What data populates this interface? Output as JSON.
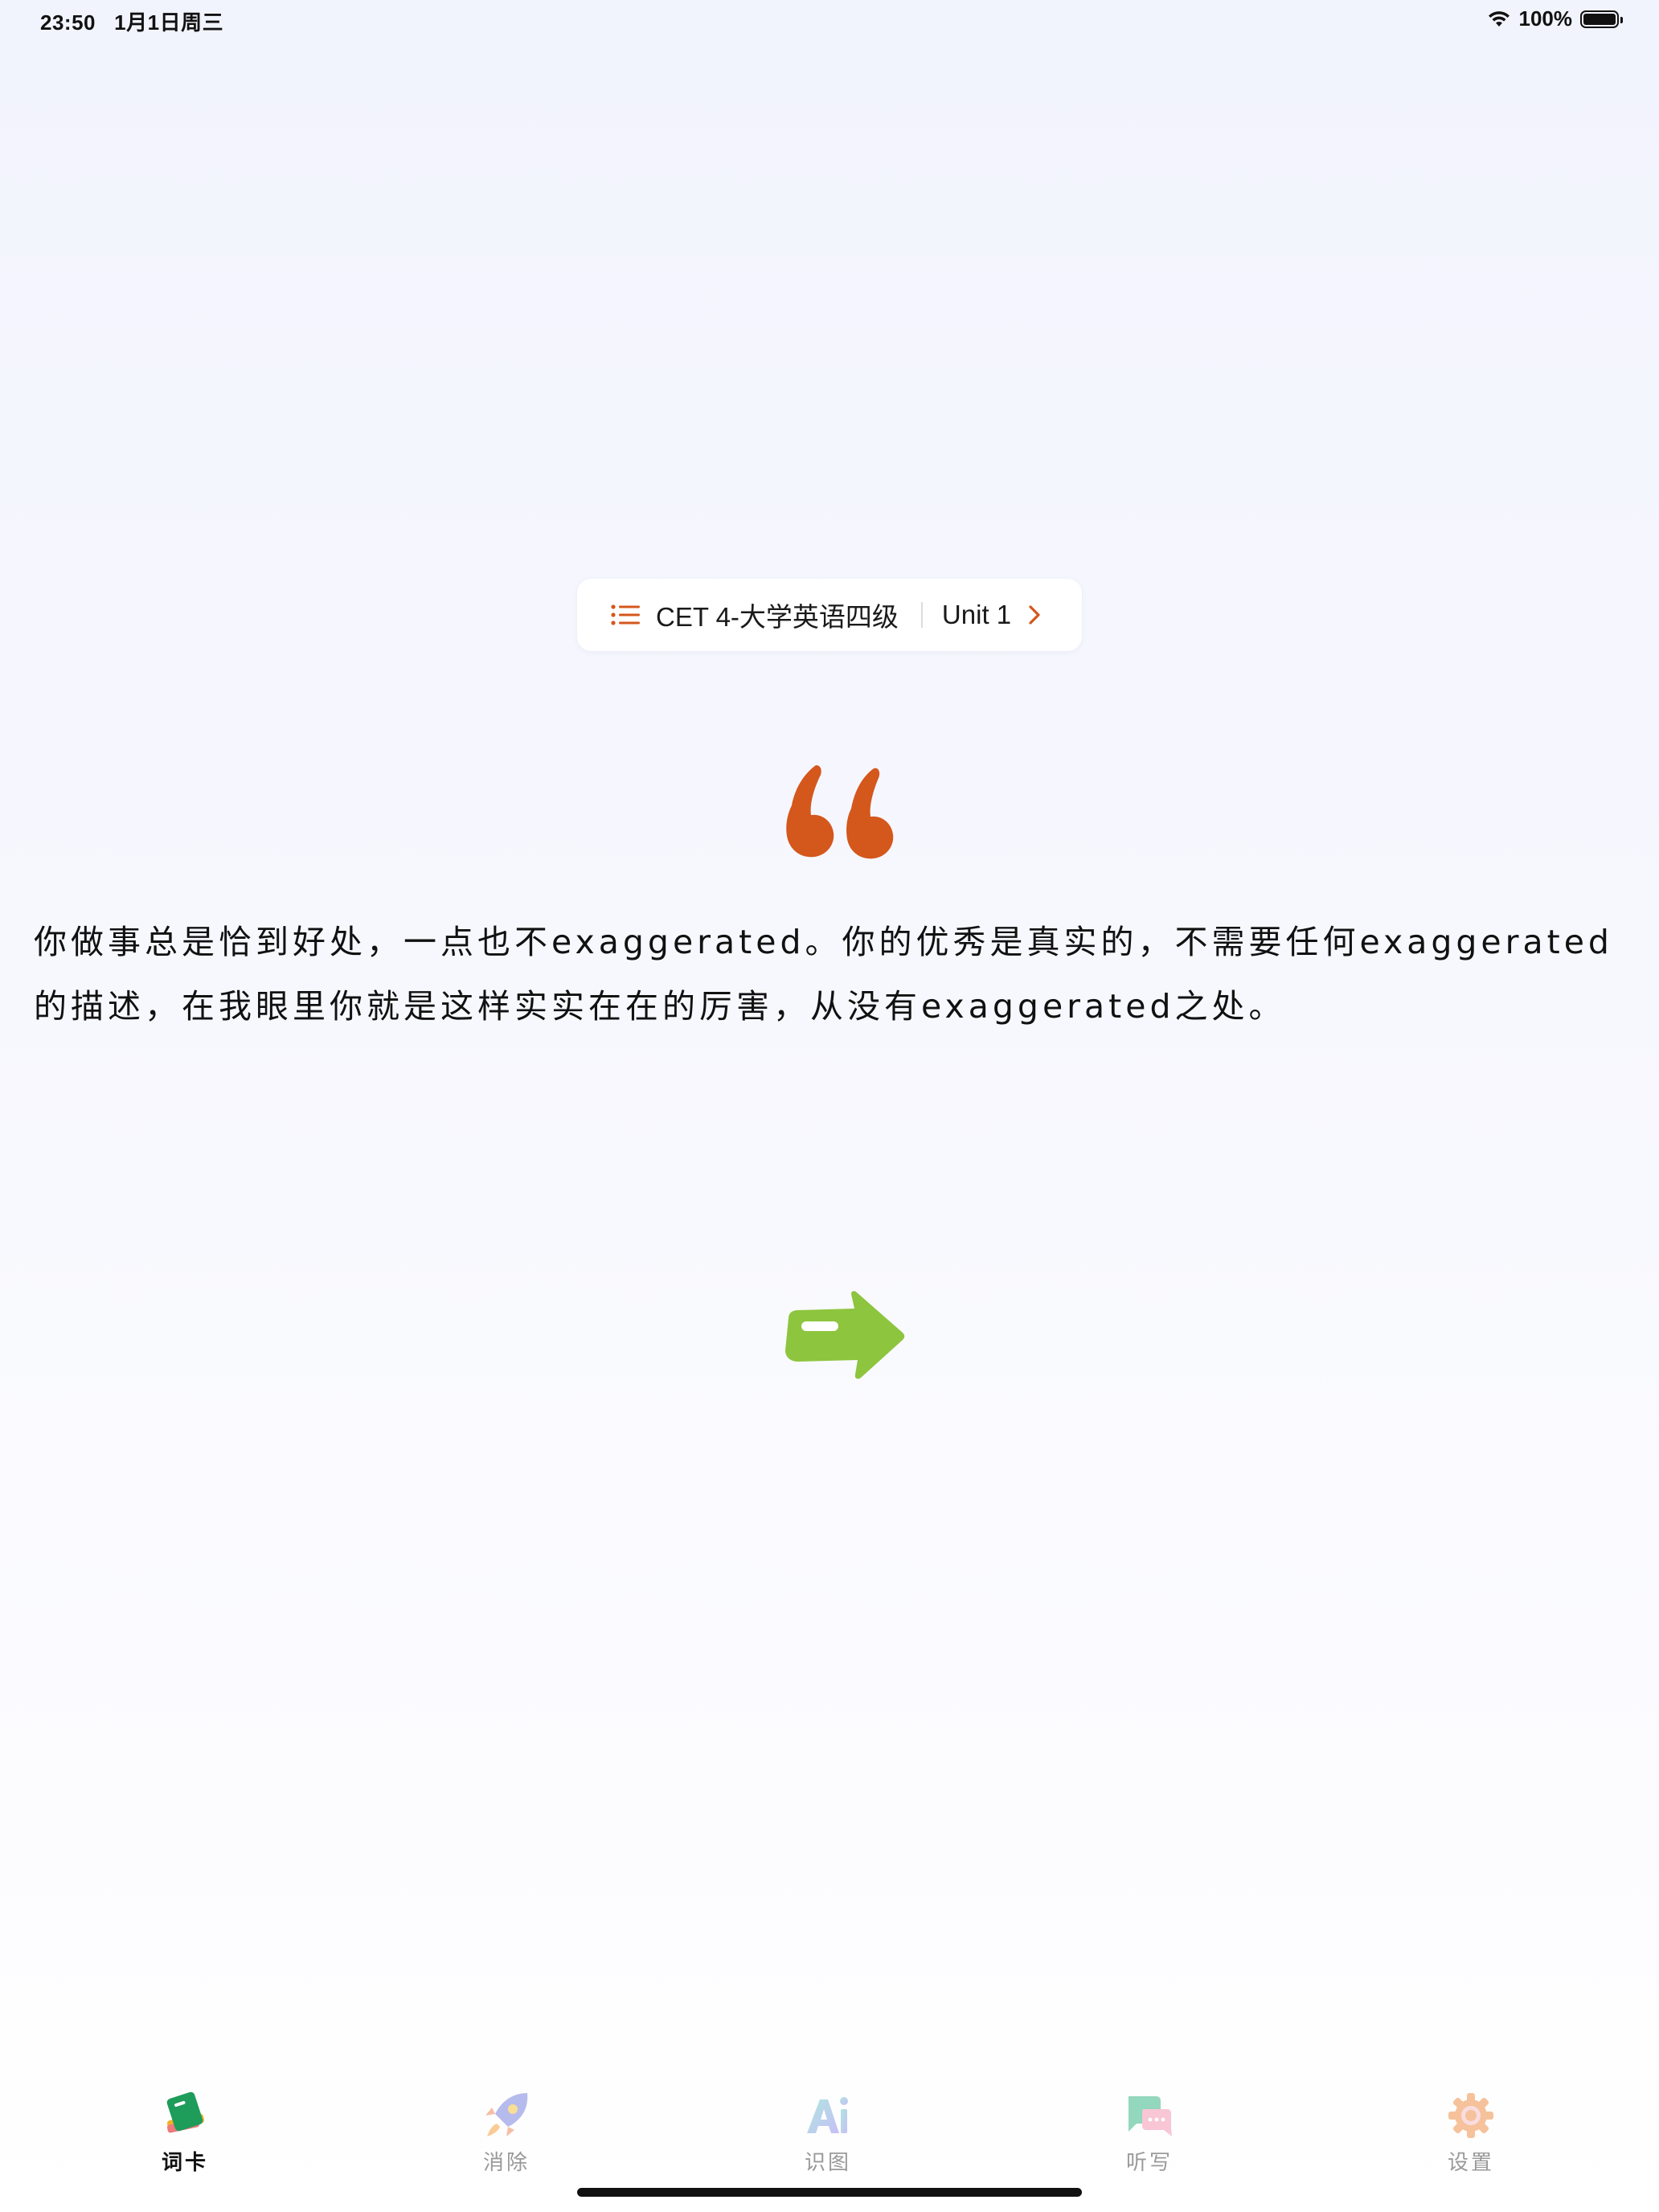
{
  "status_bar": {
    "time": "23:50",
    "date": "1月1日周三",
    "battery_text": "100%",
    "battery_level": 1.0,
    "icons": [
      "wifi-icon",
      "battery-icon"
    ]
  },
  "book_selector": {
    "book_name": "CET 4-大学英语四级",
    "unit": "Unit 1",
    "accent_color": "#d4571c"
  },
  "example": {
    "sentence": "你做事总是恰到好处，一点也不exaggerated。你的优秀是真实的，不需要任何exaggerated的描述，在我眼里你就是这样实实在在的厉害，从没有exaggerated之处。"
  },
  "colors": {
    "quote": "#d4571c",
    "arrow": "#8dc53e"
  },
  "tabs": [
    {
      "label": "词卡",
      "icon": "word-card-book-icon",
      "active": true
    },
    {
      "label": "消除",
      "icon": "rocket-icon",
      "active": false
    },
    {
      "label": "识图",
      "icon": "ai-recognize-icon",
      "active": false
    },
    {
      "label": "听写",
      "icon": "dictation-chat-icon",
      "active": false
    },
    {
      "label": "设置",
      "icon": "gear-icon",
      "active": false
    }
  ]
}
